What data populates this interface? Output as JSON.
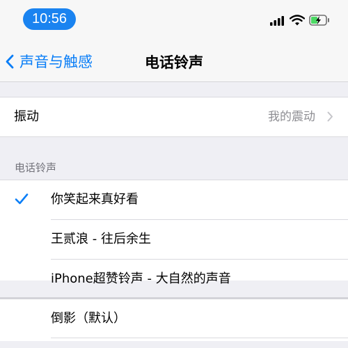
{
  "status_bar": {
    "time": "10:56"
  },
  "nav": {
    "back_label": "声音与触感",
    "title": "电话铃声"
  },
  "vibration": {
    "label": "振动",
    "value": "我的震动"
  },
  "ringtone_section": {
    "header": "电话铃声",
    "items": [
      {
        "label": "你笑起来真好看",
        "selected": true
      },
      {
        "label": "王贰浪 - 往后余生",
        "selected": false
      },
      {
        "label": "iPhone超赞铃声 - 大自然的声音",
        "selected": false
      }
    ]
  },
  "default_tone": {
    "label": "倒影（默认）"
  },
  "colors": {
    "accent": "#0a7ef7",
    "time_pill": "#1a83f0",
    "battery": "#4cd964",
    "background": "#efeff4"
  },
  "icons": [
    "signal-icon",
    "wifi-icon",
    "battery-icon",
    "chevron-left-icon",
    "chevron-right-icon",
    "checkmark-icon"
  ]
}
